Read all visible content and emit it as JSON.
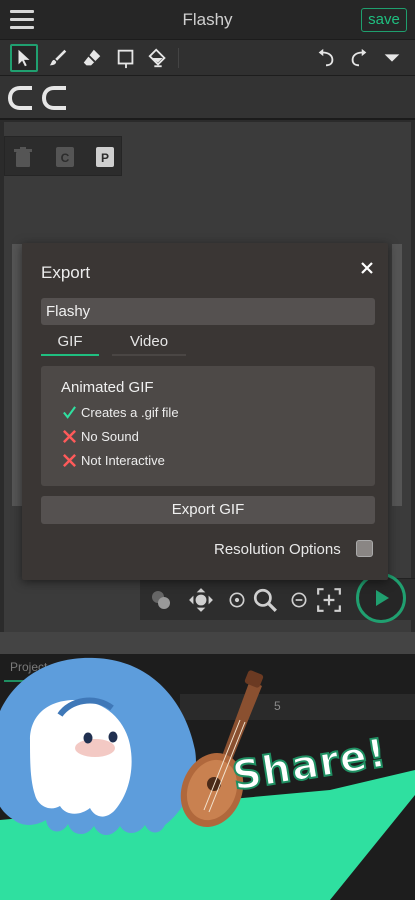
{
  "app": {
    "title": "Flashy",
    "save_label": "save"
  },
  "toolbar": {
    "tools": [
      "select-icon",
      "brush-icon",
      "eraser-icon",
      "rectangle-icon",
      "fill-icon"
    ],
    "actions": [
      "undo-icon",
      "redo-icon",
      "dropdown-icon"
    ],
    "active_tool": "select-icon"
  },
  "layer_tools": [
    "trash-icon",
    "copy-icon",
    "paste-icon"
  ],
  "export_dialog": {
    "title": "Export",
    "close_icon": "×",
    "name_value": "Flashy",
    "tabs": [
      {
        "label": "GIF",
        "active": true
      },
      {
        "label": "Video",
        "active": false
      }
    ],
    "info": {
      "title": "Animated GIF",
      "features": [
        {
          "icon": "check-icon",
          "text": "Creates a .gif file"
        },
        {
          "icon": "cross-icon",
          "text": "No Sound"
        },
        {
          "icon": "cross-icon",
          "text": "Not Interactive"
        }
      ]
    },
    "export_button_label": "Export GIF",
    "resolution_label": "Resolution Options",
    "resolution_checked": false
  },
  "timeline": {
    "tab_label": "Project",
    "frame_numbers": [
      "5"
    ]
  },
  "promo": {
    "headline": "Share!"
  },
  "colors": {
    "accent": "#1fbf80",
    "accent_dark": "#1f8f62",
    "promo_green": "#2fe0a0",
    "cross": "#ff4d4d",
    "dialog_bg": "#3a3634"
  }
}
